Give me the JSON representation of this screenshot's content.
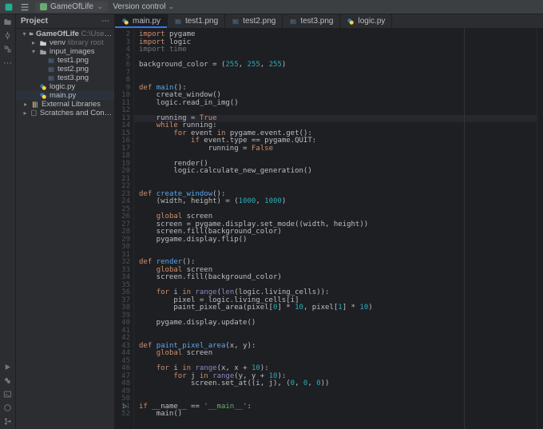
{
  "menubar": {
    "project_name": "GameOfLife",
    "vcs_label": "Version control"
  },
  "sidebar": {
    "title": "Project",
    "tree": {
      "root_name": "GameOfLife",
      "root_path": "C:\\Users\\John\\Pycharm",
      "venv": "venv",
      "venv_tag": "library root",
      "input_images": "input_images",
      "img1": "test1.png",
      "img2": "test2.png",
      "img3": "test3.png",
      "logic": "logic.py",
      "main": "main.py",
      "extlib": "External Libraries",
      "scratches": "Scratches and Consoles"
    }
  },
  "tabs": [
    {
      "label": "main.py",
      "kind": "py",
      "active": true
    },
    {
      "label": "test1.png",
      "kind": "img",
      "active": false
    },
    {
      "label": "test2.png",
      "kind": "img",
      "active": false
    },
    {
      "label": "test3.png",
      "kind": "img",
      "active": false
    },
    {
      "label": "logic.py",
      "kind": "py",
      "active": false
    }
  ],
  "editor": {
    "first_line": 2,
    "last_line": 52,
    "highlight_line": 13,
    "run_markers_at": [
      51
    ]
  },
  "code_tokens": [
    [
      [
        "impkw",
        "import"
      ],
      [
        "op",
        " "
      ],
      [
        "op",
        "pygame"
      ]
    ],
    [
      [
        "impkw",
        "import"
      ],
      [
        "op",
        " "
      ],
      [
        "op",
        "logic"
      ]
    ],
    [
      [
        "impmod",
        "import"
      ],
      [
        "op",
        " "
      ],
      [
        "impmod",
        "time"
      ]
    ],
    [],
    [
      [
        "op",
        "background_color = ("
      ],
      [
        "num",
        "255"
      ],
      [
        "op",
        ", "
      ],
      [
        "num",
        "255"
      ],
      [
        "op",
        ", "
      ],
      [
        "num",
        "255"
      ],
      [
        "op",
        ")"
      ]
    ],
    [],
    [],
    [
      [
        "kw",
        "def "
      ],
      [
        "fn",
        "main"
      ],
      [
        "op",
        "():"
      ]
    ],
    [
      [
        "op",
        "    create_window()"
      ]
    ],
    [
      [
        "op",
        "    logic.read_in_img()"
      ]
    ],
    [],
    [
      [
        "op",
        "    running = "
      ],
      [
        "bool",
        "True"
      ]
    ],
    [
      [
        "op",
        "    "
      ],
      [
        "kw",
        "while "
      ],
      [
        "op",
        "running:"
      ]
    ],
    [
      [
        "op",
        "        "
      ],
      [
        "kw",
        "for "
      ],
      [
        "op",
        "event "
      ],
      [
        "kw",
        "in "
      ],
      [
        "op",
        "pygame.event.get():"
      ]
    ],
    [
      [
        "op",
        "            "
      ],
      [
        "kw",
        "if "
      ],
      [
        "op",
        "event.type == pygame.QUIT:"
      ]
    ],
    [
      [
        "op",
        "                running = "
      ],
      [
        "bool",
        "False"
      ]
    ],
    [],
    [
      [
        "op",
        "        render()"
      ]
    ],
    [
      [
        "op",
        "        logic.calculate_new_generation()"
      ]
    ],
    [],
    [],
    [
      [
        "kw",
        "def "
      ],
      [
        "fn",
        "create_window"
      ],
      [
        "op",
        "():"
      ]
    ],
    [
      [
        "op",
        "    (width, height) = ("
      ],
      [
        "num",
        "1000"
      ],
      [
        "op",
        ", "
      ],
      [
        "num",
        "1000"
      ],
      [
        "op",
        ")"
      ]
    ],
    [],
    [
      [
        "op",
        "    "
      ],
      [
        "kw",
        "global "
      ],
      [
        "op",
        "screen"
      ]
    ],
    [
      [
        "op",
        "    screen = pygame.display.set_mode((width, height))"
      ]
    ],
    [
      [
        "op",
        "    screen.fill(background_color)"
      ]
    ],
    [
      [
        "op",
        "    pygame.display.flip()"
      ]
    ],
    [],
    [],
    [
      [
        "kw",
        "def "
      ],
      [
        "fn",
        "render"
      ],
      [
        "op",
        "():"
      ]
    ],
    [
      [
        "op",
        "    "
      ],
      [
        "kw",
        "global "
      ],
      [
        "op",
        "screen"
      ]
    ],
    [
      [
        "op",
        "    screen.fill(background_color)"
      ]
    ],
    [],
    [
      [
        "op",
        "    "
      ],
      [
        "kw",
        "for "
      ],
      [
        "op",
        "i "
      ],
      [
        "kw",
        "in "
      ],
      [
        "builtin",
        "range"
      ],
      [
        "op",
        "("
      ],
      [
        "builtin",
        "len"
      ],
      [
        "op",
        "(logic.living_cells)):"
      ]
    ],
    [
      [
        "op",
        "        pixel = logic.living_cells[i]"
      ]
    ],
    [
      [
        "op",
        "        paint_pixel_area(pixel["
      ],
      [
        "num",
        "0"
      ],
      [
        "op",
        "] * "
      ],
      [
        "num",
        "10"
      ],
      [
        "op",
        ", pixel["
      ],
      [
        "num",
        "1"
      ],
      [
        "op",
        "] * "
      ],
      [
        "num",
        "10"
      ],
      [
        "op",
        ")"
      ]
    ],
    [],
    [
      [
        "op",
        "    pygame.display.update()"
      ]
    ],
    [],
    [],
    [
      [
        "kw",
        "def "
      ],
      [
        "fn",
        "paint_pixel_area"
      ],
      [
        "op",
        "(x, y):"
      ]
    ],
    [
      [
        "op",
        "    "
      ],
      [
        "kw",
        "global "
      ],
      [
        "op",
        "screen"
      ]
    ],
    [],
    [
      [
        "op",
        "    "
      ],
      [
        "kw",
        "for "
      ],
      [
        "op",
        "i "
      ],
      [
        "kw",
        "in "
      ],
      [
        "builtin",
        "range"
      ],
      [
        "op",
        "(x, x + "
      ],
      [
        "num",
        "10"
      ],
      [
        "op",
        "):"
      ]
    ],
    [
      [
        "op",
        "        "
      ],
      [
        "kw",
        "for "
      ],
      [
        "op",
        "j "
      ],
      [
        "kw",
        "in "
      ],
      [
        "builtin",
        "range"
      ],
      [
        "op",
        "(y, y + "
      ],
      [
        "num",
        "10"
      ],
      [
        "op",
        "):"
      ]
    ],
    [
      [
        "op",
        "            screen.set_at((i, j), ("
      ],
      [
        "num",
        "0"
      ],
      [
        "op",
        ", "
      ],
      [
        "num",
        "0"
      ],
      [
        "op",
        ", "
      ],
      [
        "num",
        "0"
      ],
      [
        "op",
        "))"
      ]
    ],
    [],
    [],
    [
      [
        "kw",
        "if "
      ],
      [
        "op",
        "__name__ == "
      ],
      [
        "str",
        "'__main__'"
      ],
      [
        "op",
        ":"
      ]
    ],
    [
      [
        "op",
        "    main()"
      ]
    ]
  ]
}
